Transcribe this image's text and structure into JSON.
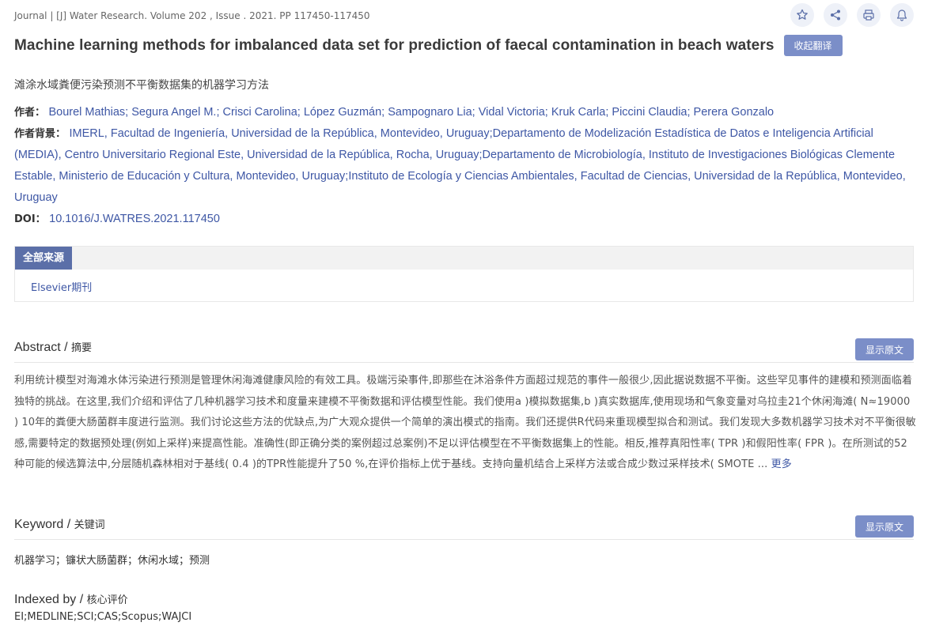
{
  "header": {
    "journal_info": "Journal | [J] Water Research. Volume 202 , Issue . 2021. PP 117450-117450",
    "icons": [
      "star-icon",
      "share-icon",
      "print-icon",
      "bell-icon"
    ]
  },
  "article": {
    "title": "Machine learning methods for imbalanced data set for prediction of faecal contamination in beach waters",
    "collapse_translation_label": "收起翻译",
    "title_cn": "滩涂水域粪便污染预测不平衡数据集的机器学习方法",
    "authors_label": "作者：",
    "authors": "Bourel Mathias; Segura Angel M.; Crisci Carolina; López Guzmán; Sampognaro Lia; Vidal Victoria; Kruk Carla; Piccini Claudia; Perera Gonzalo",
    "affiliation_label": "作者背景：",
    "affiliation": "IMERL, Facultad de Ingeniería, Universidad de la República, Montevideo, Uruguay;Departamento de Modelización Estadística de Datos e Inteligencia Artificial (MEDIA), Centro Universitario Regional Este, Universidad de la República, Rocha, Uruguay;Departamento de Microbiología, Instituto de Investigaciones Biológicas Clemente Estable, Ministerio de Educación y Cultura, Montevideo, Uruguay;Instituto de Ecología y Ciencias Ambientales, Facultad de Ciencias, Universidad de la República, Montevideo, Uruguay",
    "doi_label": "DOI：",
    "doi": "10.1016/J.WATRES.2021.117450"
  },
  "sources": {
    "tab_label": "全部来源",
    "items": [
      "Elsevier期刊"
    ]
  },
  "abstract": {
    "heading_en": "Abstract / ",
    "heading_cn": "摘要",
    "show_original_label": "显示原文",
    "text": "利用统计模型对海滩水体污染进行预测是管理休闲海滩健康风险的有效工具。极端污染事件,即那些在沐浴条件方面超过规范的事件一般很少,因此据说数据不平衡。这些罕见事件的建模和预测面临着独特的挑战。在这里,我们介绍和评估了几种机器学习技术和度量来建模不平衡数据和评估模型性能。我们使用a )模拟数据集,b )真实数据库,使用现场和气象变量对乌拉圭21个休闲海滩( N≈19000 ) 10年的粪便大肠菌群丰度进行监测。我们讨论这些方法的优缺点,为广大观众提供一个简单的演出模式的指南。我们还提供R代码来重现模型拟合和测试。我们发现大多数机器学习技术对不平衡很敏感,需要特定的数据预处理(例如上采样)来提高性能。准确性(即正确分类的案例超过总案例)不足以评估模型在不平衡数据集上的性能。相反,推荐真阳性率( TPR )和假阳性率( FPR )。在所测试的52种可能的候选算法中,分层随机森林相对于基线( 0.4 )的TPR性能提升了50 %,在评价指标上优于基线。支持向量机结合上采样方法或合成少数过采样技术( SMOTE ... ",
    "more_label": "更多"
  },
  "keyword": {
    "heading_en": "Keyword / ",
    "heading_cn": "关键词",
    "show_original_label": "显示原文",
    "text": "机器学习；镰状大肠菌群；休闲水域；预测"
  },
  "indexed": {
    "heading_en": "Indexed by / ",
    "heading_cn": "核心评价",
    "text": "EI;MEDLINE;SCI;CAS;Scopus;WAJCI"
  }
}
